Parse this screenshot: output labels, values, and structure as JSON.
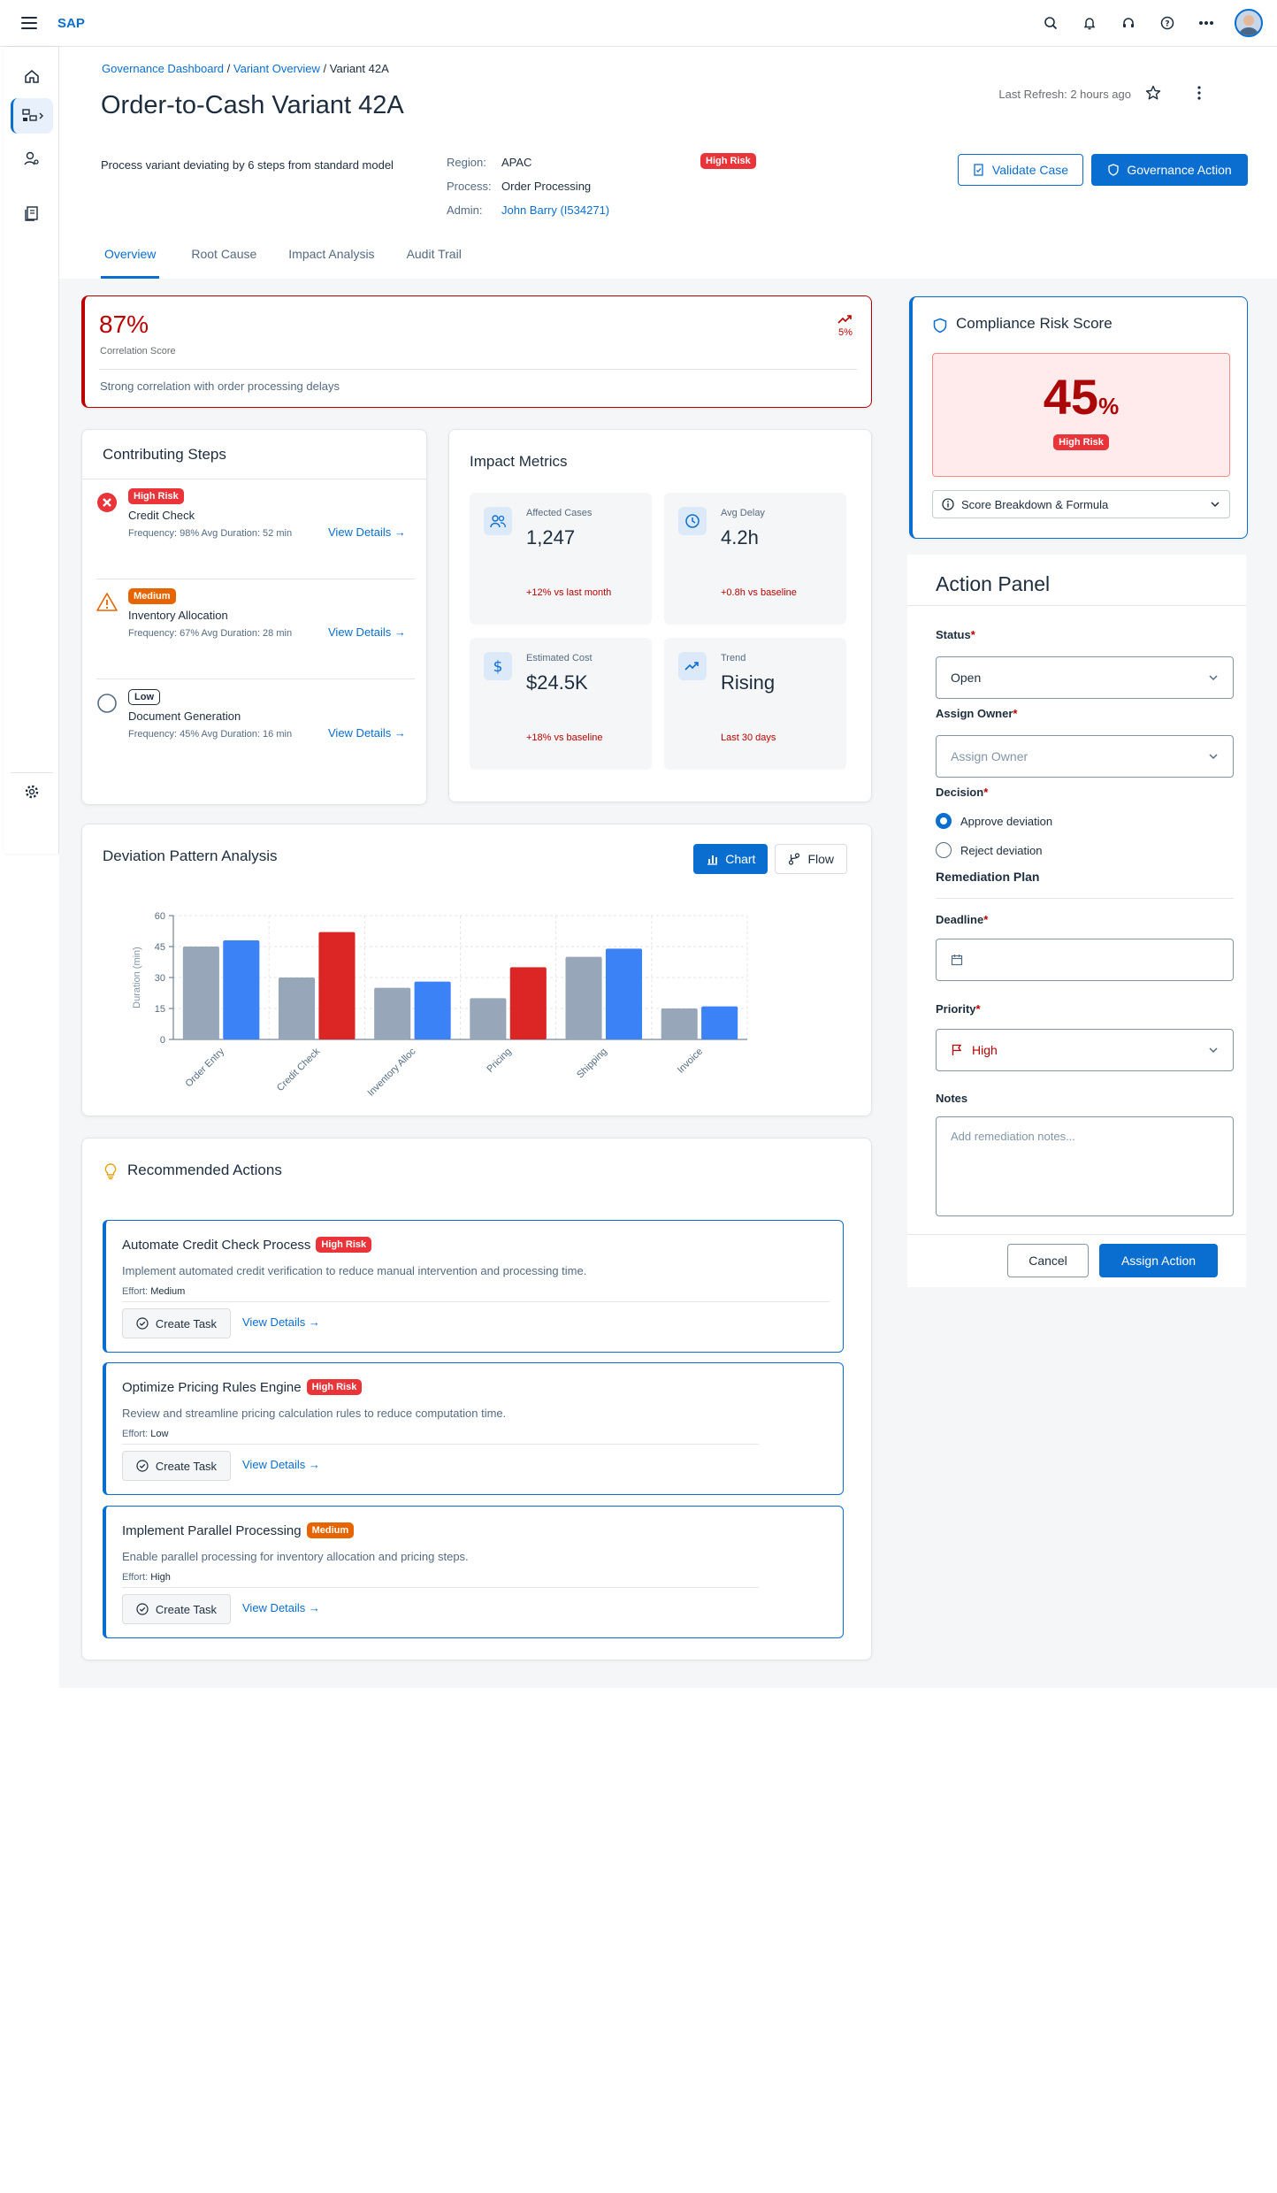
{
  "shell": {
    "logo": "SAP"
  },
  "header": {
    "breadcrumb": [
      "Governance Dashboard",
      "Variant Overview",
      "Variant 42A"
    ],
    "title": "Order-to-Cash Variant 42A",
    "last_refresh": "Last Refresh: 2 hours ago",
    "description": "Process variant deviating by 6 steps from standard model",
    "attributes": [
      {
        "key": "Region:",
        "value": "APAC"
      },
      {
        "key": "Process:",
        "value": "Order Processing"
      },
      {
        "key": "Admin:",
        "value": "John Barry (I534271)"
      }
    ],
    "risk_chip": "High Risk",
    "validate_label": "Validate Case",
    "governance_label": "Governance Action",
    "tabs": [
      "Overview",
      "Root Cause",
      "Impact Analysis",
      "Audit Trail"
    ],
    "active_tab": "Overview"
  },
  "correlation": {
    "value": "87%",
    "label": "Correlation Score",
    "trend": "5%",
    "note": "Strong correlation with order processing delays"
  },
  "contributing_steps": {
    "title": "Contributing Steps",
    "items": [
      {
        "severity": "High Risk",
        "name": "Credit Check",
        "meta": "Frequency: 98%   Avg Duration: 52 min",
        "link": "View Details →"
      },
      {
        "severity": "Medium",
        "name": "Inventory Allocation",
        "meta": "Frequency: 67%   Avg Duration: 28 min",
        "link": "View Details →"
      },
      {
        "severity": "Low",
        "name": "Document Generation",
        "meta": "Frequency: 45%   Avg Duration: 16 min",
        "link": "View Details →"
      }
    ]
  },
  "impact_metrics": {
    "title": "Impact Metrics",
    "items": [
      {
        "label": "Affected Cases",
        "value": "1,247",
        "delta": "+12% vs last month",
        "icon": "users-icon"
      },
      {
        "label": "Avg Delay",
        "value": "4.2h",
        "delta": "+0.8h vs baseline",
        "icon": "clock-icon"
      },
      {
        "label": "Estimated Cost",
        "value": "$24.5K",
        "delta": "+18% vs baseline",
        "icon": "dollar-icon"
      },
      {
        "label": "Trend",
        "value": "Rising",
        "delta": "Last 30 days",
        "icon": "trend-up-icon"
      }
    ]
  },
  "compliance": {
    "title": "Compliance Risk Score",
    "score": "45",
    "unit": "%",
    "chip": "High Risk",
    "breakdown": "Score Breakdown & Formula"
  },
  "action_panel": {
    "title": "Action Panel",
    "status_label": "Status",
    "status_value": "Open",
    "owner_label": "Assign Owner",
    "owner_placeholder": "Assign Owner",
    "decision_label": "Decision",
    "decision_options": [
      "Approve deviation",
      "Reject deviation"
    ],
    "decision_selected": "Approve deviation",
    "remediation_label": "Remediation Plan",
    "deadline_label": "Deadline",
    "priority_label": "Priority",
    "priority_value": "High",
    "notes_label": "Notes",
    "notes_placeholder": "Add remediation notes...",
    "cancel_label": "Cancel",
    "assign_label": "Assign Action"
  },
  "deviation_chart": {
    "title": "Deviation Pattern Analysis",
    "chart_label": "Chart",
    "flow_label": "Flow"
  },
  "chart_data": {
    "type": "bar",
    "categories": [
      "Order Entry",
      "Credit Check",
      "Inventory Alloc",
      "Pricing",
      "Shipping",
      "Invoice"
    ],
    "series": [
      {
        "values": [
          45,
          30,
          25,
          20,
          40,
          15
        ],
        "color": "#98a6b9"
      },
      {
        "values": [
          48,
          52,
          28,
          35,
          44,
          16
        ],
        "colors": [
          "#3b82f6",
          "#dc2626",
          "#3b82f6",
          "#dc2626",
          "#3b82f6",
          "#3b82f6"
        ]
      }
    ],
    "ylabel": "Duration (min)",
    "ylim": [
      0,
      60
    ],
    "yticks": [
      0,
      15,
      30,
      45,
      60
    ],
    "grid": true
  },
  "recommended": {
    "title": "Recommended Actions",
    "items": [
      {
        "name": "Automate Credit Check Process",
        "chip": "High Risk",
        "desc": "Implement automated credit verification to reduce manual intervention and processing time.",
        "effort_label": "Effort:",
        "effort": "Medium",
        "task": "Create Task",
        "link": "View Details →"
      },
      {
        "name": "Optimize Pricing Rules Engine",
        "chip": "High Risk",
        "desc": "Review and streamline pricing calculation rules to reduce computation time.",
        "effort_label": "Effort:",
        "effort": "Low",
        "task": "Create Task",
        "link": "View Details →"
      },
      {
        "name": "Implement Parallel Processing",
        "chip": "Medium",
        "desc": "Enable parallel processing for inventory allocation and pricing steps.",
        "effort_label": "Effort:",
        "effort": "High",
        "task": "Create Task",
        "link": "View Details →"
      }
    ]
  }
}
